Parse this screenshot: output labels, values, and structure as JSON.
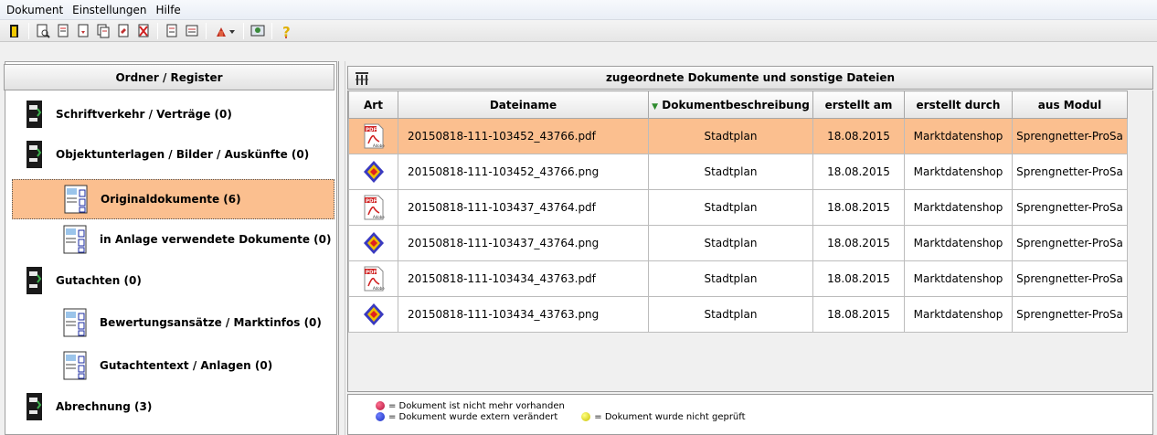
{
  "menu": [
    "Dokument",
    "Einstellungen",
    "Hilfe"
  ],
  "toolbar": {
    "icons": [
      "exit-icon",
      "search-doc-icon",
      "doc-edit-icon",
      "doc-arrow-icon",
      "doc-copy-icon",
      "doc-move-icon",
      "doc-delete-icon",
      "doc-new-icon",
      "doc-save-icon",
      "tools-dropdown-icon",
      "preview-icon",
      "help-icon"
    ]
  },
  "left": {
    "header": "Ordner / Register",
    "items": [
      {
        "label": "Schriftverkehr / Verträge (0)",
        "type": "book"
      },
      {
        "label": "Objektunterlagen / Bilder / Auskünfte (0)",
        "type": "book"
      },
      {
        "label": "Originaldokumente (6)",
        "type": "doc",
        "selected": true
      },
      {
        "label": "in Anlage verwendete Dokumente (0)",
        "type": "doc"
      },
      {
        "label": "Gutachten (0)",
        "type": "book"
      },
      {
        "label": "Bewertungsansätze / Marktinfos (0)",
        "type": "doc"
      },
      {
        "label": "Gutachtentext / Anlagen (0)",
        "type": "doc"
      },
      {
        "label": "Abrechnung (3)",
        "type": "book"
      }
    ]
  },
  "right": {
    "header": "zugeordnete Dokumente und sonstige Dateien",
    "columns": [
      "Art",
      "Dateiname",
      "Dokumentbeschreibung",
      "erstellt am",
      "erstellt durch",
      "aus Modul"
    ],
    "sort_indicator": "▼",
    "rows": [
      {
        "art": "pdf",
        "file": "20150818-111-103452_43766.pdf",
        "desc": "Stadtplan",
        "date": "18.08.2015",
        "by": "Marktdatenshop",
        "module": "Sprengnetter-ProSa",
        "selected": true
      },
      {
        "art": "png",
        "file": "20150818-111-103452_43766.png",
        "desc": "Stadtplan",
        "date": "18.08.2015",
        "by": "Marktdatenshop",
        "module": "Sprengnetter-ProSa"
      },
      {
        "art": "pdf",
        "file": "20150818-111-103437_43764.pdf",
        "desc": "Stadtplan",
        "date": "18.08.2015",
        "by": "Marktdatenshop",
        "module": "Sprengnetter-ProSa"
      },
      {
        "art": "png",
        "file": "20150818-111-103437_43764.png",
        "desc": "Stadtplan",
        "date": "18.08.2015",
        "by": "Marktdatenshop",
        "module": "Sprengnetter-ProSa"
      },
      {
        "art": "pdf",
        "file": "20150818-111-103434_43763.pdf",
        "desc": "Stadtplan",
        "date": "18.08.2015",
        "by": "Marktdatenshop",
        "module": "Sprengnetter-ProSa"
      },
      {
        "art": "png",
        "file": "20150818-111-103434_43763.png",
        "desc": "Stadtplan",
        "date": "18.08.2015",
        "by": "Marktdatenshop",
        "module": "Sprengnetter-ProSa"
      }
    ]
  },
  "legend": {
    "missing": "= Dokument ist nicht mehr vorhanden",
    "changed": "= Dokument wurde extern verändert",
    "unchecked": "= Dokument wurde nicht geprüft",
    "colors": {
      "missing": "#b0103a",
      "changed": "#1a2fc0",
      "unchecked": "#d8d000"
    }
  },
  "colors": {
    "selection": "#fbbf8f"
  }
}
